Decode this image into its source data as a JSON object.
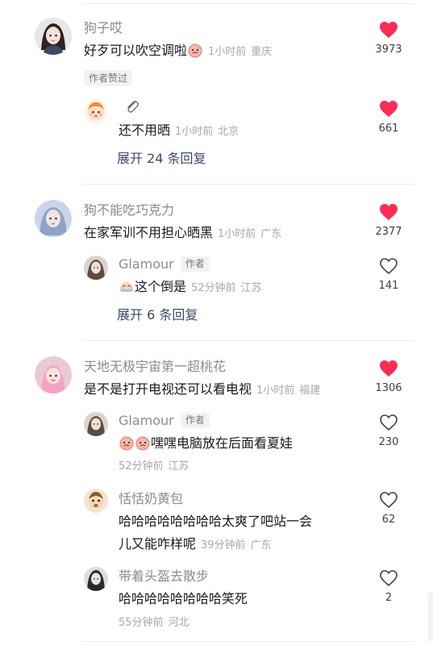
{
  "comments": [
    {
      "username": "狗子哎",
      "text": "好歹可以吹空调啦",
      "emoji": "sweat-face-emoji",
      "time": "1小时前",
      "location": "重庆",
      "likes": "3973",
      "liked": true,
      "badge": "作者赞过",
      "replies": [
        {
          "username": "",
          "text": "还不用晒",
          "time": "1小时前",
          "location": "北京",
          "likes": "661",
          "liked": true
        }
      ],
      "expand_label": "展开 24 条回复"
    },
    {
      "username": "狗不能吃巧克力",
      "text": "在家军训不用担心晒黑",
      "time": "1小时前",
      "location": "广东",
      "likes": "2377",
      "liked": true,
      "replies": [
        {
          "username": "Glamour",
          "author_tag": "作者",
          "text": "这个倒是",
          "emoji": "relieved-emoji",
          "time": "52分钟前",
          "location": "江苏",
          "likes": "141",
          "liked": false
        }
      ],
      "expand_label": "展开 6 条回复"
    },
    {
      "username": "天地无极宇宙第一超桃花",
      "text": "是不是打开电视还可以看电视",
      "time": "1小时前",
      "location": "福建",
      "likes": "1306",
      "liked": true,
      "replies": [
        {
          "username": "Glamour",
          "author_tag": "作者",
          "text": "嘿嘿电脑放在后面看夏娃",
          "emoji": "sweat-face-emoji",
          "time": "52分钟前",
          "location": "江苏",
          "likes": "230",
          "liked": false
        },
        {
          "username": "恬恬奶黄包",
          "text_line1": "哈哈哈哈哈哈哈哈太爽了吧站一会",
          "text_line2": "儿又能咋样呢",
          "time": "39分钟前",
          "location": "广东",
          "likes": "62",
          "liked": false
        },
        {
          "username": "带着头盔去散步",
          "text": "哈哈哈哈哈哈哈哈笑死",
          "time": "55分钟前",
          "location": "河北",
          "likes": "2",
          "liked": false
        }
      ]
    }
  ],
  "colors": {
    "heart_liked": "#fe2c55",
    "heart_outline": "#3d3e45",
    "username": "#8a8b91",
    "meta": "#a8a8ad",
    "expand": "#3a4a6b"
  }
}
